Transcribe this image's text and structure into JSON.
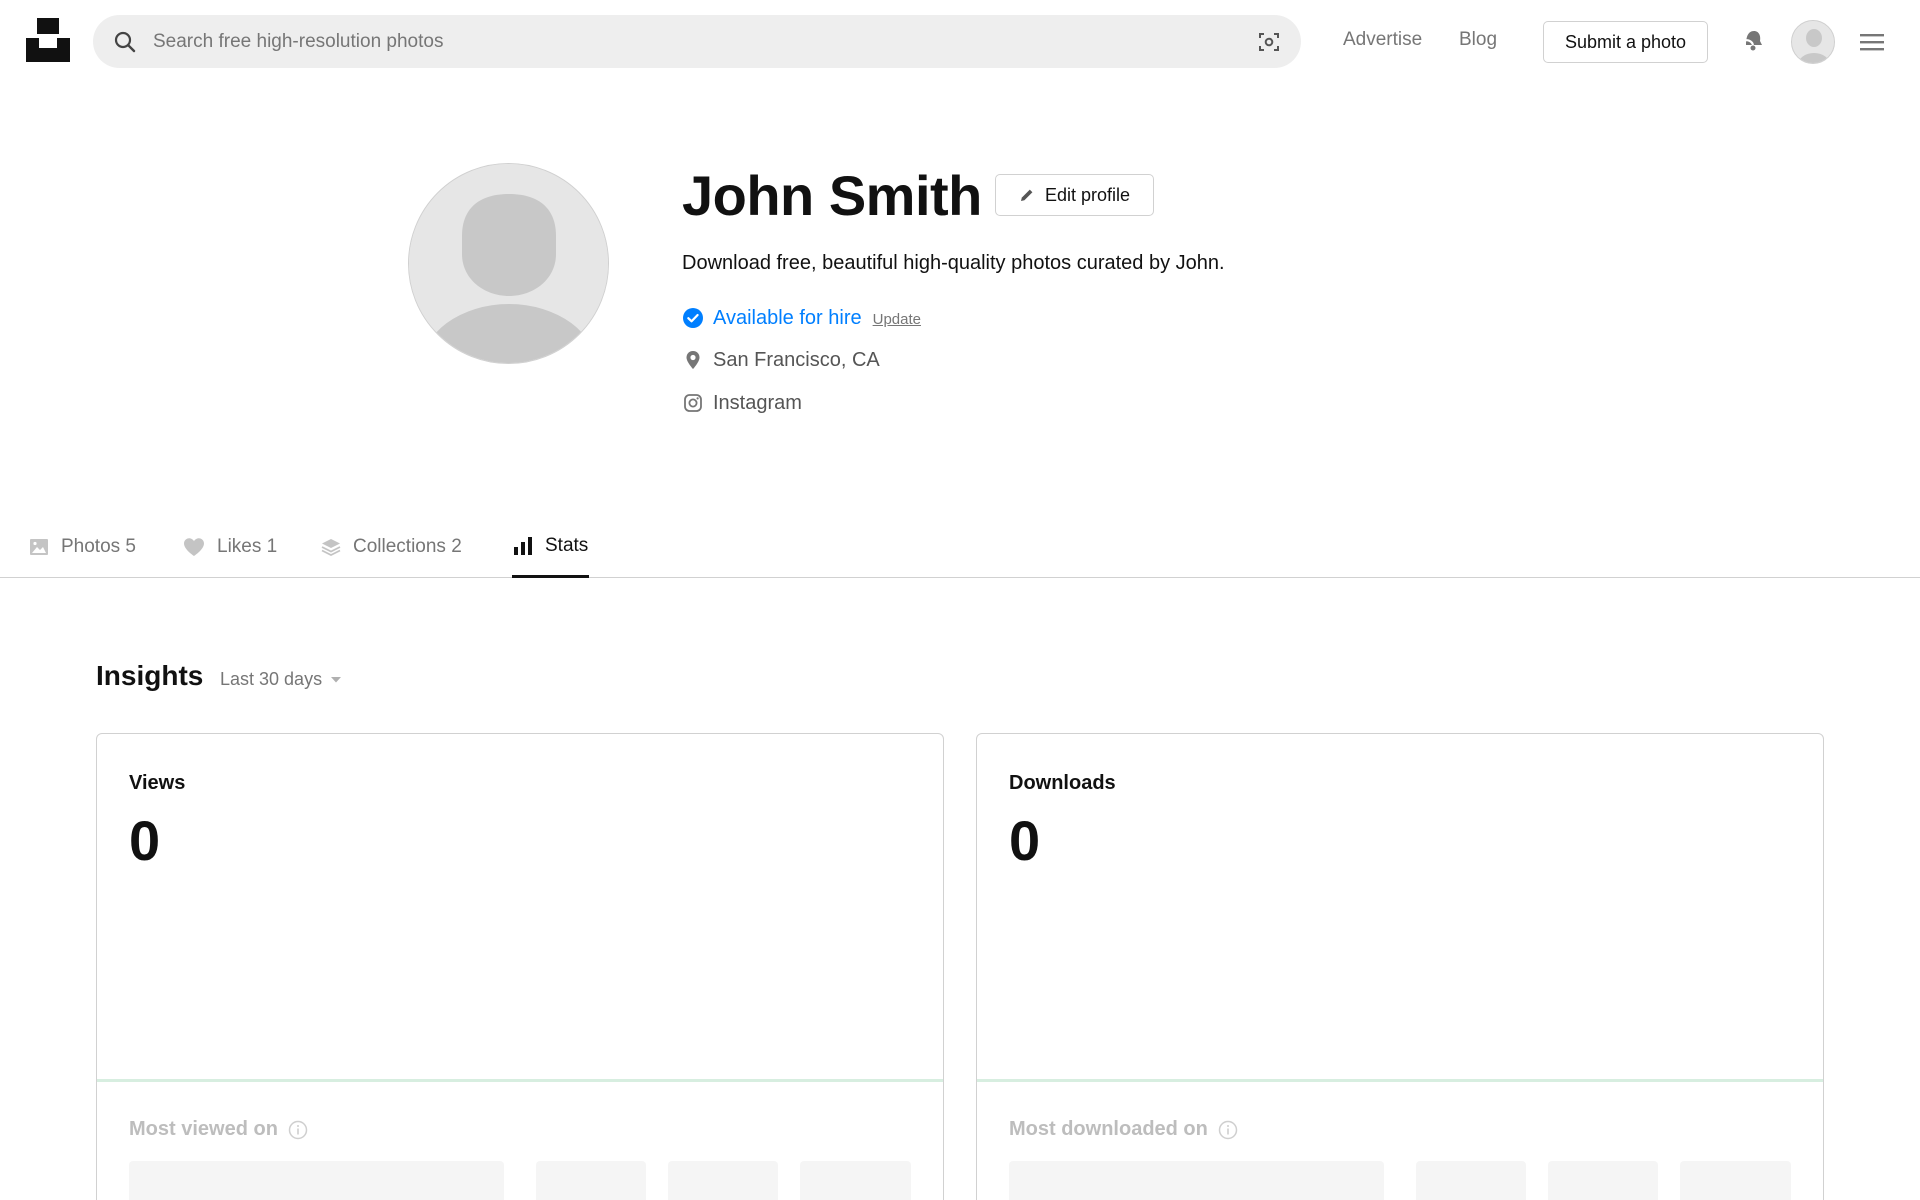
{
  "header": {
    "search_placeholder": "Search free high-resolution photos",
    "links": [
      "Advertise",
      "Blog"
    ],
    "submit_label": "Submit a photo"
  },
  "profile": {
    "name": "John Smith",
    "edit_label": "Edit profile",
    "bio": "Download free, beautiful high-quality photos curated by John.",
    "hire_text": "Available for hire",
    "update_label": "Update",
    "location": "San Francisco, CA",
    "social": "Instagram"
  },
  "tabs": [
    {
      "label": "Photos 5"
    },
    {
      "label": "Likes 1"
    },
    {
      "label": "Collections 2"
    },
    {
      "label": "Stats"
    }
  ],
  "insights": {
    "title": "Insights",
    "range": "Last 30 days",
    "cards": [
      {
        "label": "Views",
        "value": "0",
        "sub": "Most viewed on"
      },
      {
        "label": "Downloads",
        "value": "0",
        "sub": "Most downloaded on"
      }
    ]
  },
  "colors": {
    "accent_blue": "#007fff",
    "muted_text": "#767676",
    "border": "#d1d1d1",
    "baseline_green": "#d7eee0"
  }
}
